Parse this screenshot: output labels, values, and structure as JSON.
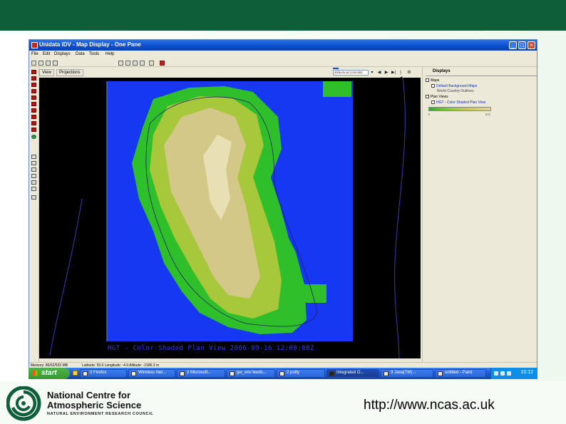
{
  "window": {
    "title": "Unidata IDV - Map Display - One Pane",
    "controls": {
      "minimize": "_",
      "maximize": "□",
      "close": "×"
    }
  },
  "menu": [
    "File",
    "Edit",
    "Displays",
    "Data",
    "Tools",
    "Help"
  ],
  "view_tabs": [
    "View",
    "Projections"
  ],
  "time_controls": {
    "selected_time": "2006-09-16 12:00:00Z",
    "buttons": [
      "◀",
      "▶",
      "▶|",
      "|◀",
      "⚙"
    ]
  },
  "map": {
    "caption": "HGT - Color-Shaded Plan View 2006-09-16 12:00:00Z",
    "colors": {
      "ocean": "#1638f2",
      "lowland": "#2fbf2b",
      "midland": "#a8c83c",
      "highland": "#d4c889",
      "peak": "#e8e0b4",
      "background": "#000000"
    }
  },
  "displays_panel": {
    "header": "Displays",
    "sections": [
      {
        "label": "Maps",
        "items": [
          {
            "label": "Default Background Maps",
            "sub": "World Country Outlines"
          }
        ]
      },
      {
        "label": "Plan Views",
        "items": [
          {
            "label": "HGT - Color-Shaded Plan View"
          }
        ]
      }
    ],
    "color_scale": {
      "min_label": "0",
      "max_label": "972"
    }
  },
  "status_bar": {
    "memory": "Memory: 80/02/533 MB",
    "coords": "Latitude: 55.6 Longitude: -4.9 Altitude: -1586.3 m"
  },
  "taskbar": {
    "start_label": "start",
    "tasks": [
      {
        "label": "2 Firefox",
        "icon": "firefox-icon"
      },
      {
        "label": "Wireless Net...",
        "icon": "network-icon"
      },
      {
        "label": "2 Microsoft...",
        "icon": "office-icon"
      },
      {
        "label": "gw_env leeds...",
        "icon": "folder-icon"
      },
      {
        "label": "2 putty",
        "icon": "terminal-icon"
      },
      {
        "label": "Integrated O...",
        "icon": "console-icon"
      },
      {
        "label": "3 Java(TM)...",
        "icon": "java-icon"
      },
      {
        "label": "untitled - Paint",
        "icon": "paint-icon"
      }
    ],
    "clock": "10:12"
  },
  "footer": {
    "org_line1": "National Centre for",
    "org_line2": "Atmospheric Science",
    "org_line3": "NATURAL ENVIRONMENT RESEARCH COUNCIL",
    "url": "http://www.ncas.ac.uk",
    "colors": {
      "banner": "#0f5e3a",
      "logo": "#0f5e3a"
    }
  }
}
